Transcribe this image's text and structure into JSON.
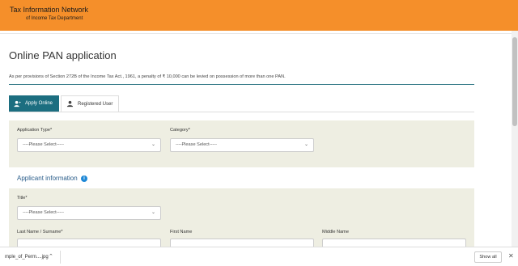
{
  "header": {
    "brand_title": "Tax Information Network",
    "brand_sub": "of Income Tax Department",
    "accent_color": "#f58f2a"
  },
  "page": {
    "title": "Online PAN application",
    "notice": "As per provisions of Section 272B of the Income Tax Act., 1961, a penalty of ₹ 10,000 can be levied on possession of more than one PAN."
  },
  "tabs": [
    {
      "label": "Apply Online",
      "icon": "person-add-icon",
      "active": true
    },
    {
      "label": "Registered User",
      "icon": "person-icon",
      "active": false
    }
  ],
  "form": {
    "application_type": {
      "label": "Application Type*",
      "value": "----Please Select-----"
    },
    "category": {
      "label": "Category*",
      "value": "----Please Select-----"
    },
    "applicant_section_title": "Applicant information",
    "title_field": {
      "label": "Title*",
      "value": "----Please Select-----"
    },
    "last_name": {
      "label": "Last Name / Surname*"
    },
    "first_name": {
      "label": "First Name"
    },
    "middle_name": {
      "label": "Middle Name"
    }
  },
  "downloads": {
    "file_name": "mple_of_Perm....jpg",
    "show_all": "Show all",
    "close": "✕"
  }
}
